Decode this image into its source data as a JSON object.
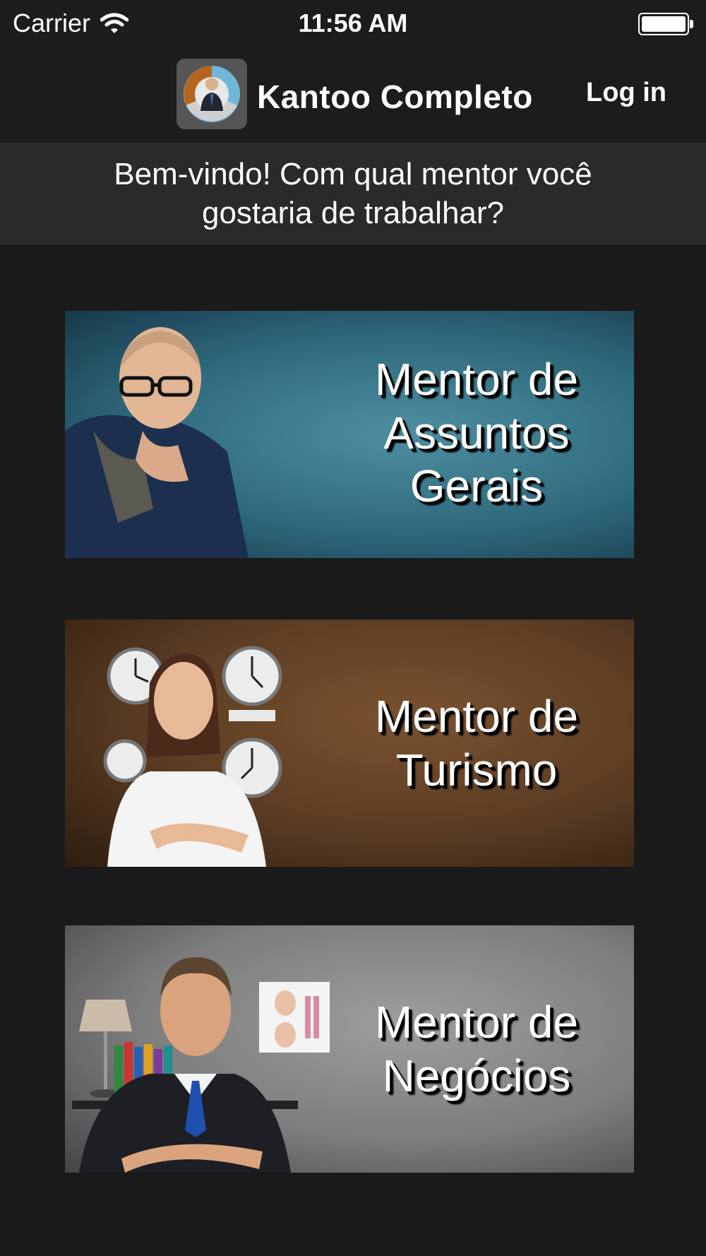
{
  "status_bar": {
    "carrier": "Carrier",
    "time": "11:56 AM",
    "battery_level": 1.0
  },
  "nav": {
    "title": "Kantoo Completo",
    "login_label": "Log in",
    "app_icon": "kantoo-app-icon"
  },
  "welcome": {
    "text": "Bem-vindo! Com qual mentor você gostaria de trabalhar?"
  },
  "mentors": [
    {
      "line1": "Mentor de",
      "line2": "Assuntos",
      "line3": "Gerais",
      "theme_color": "#3f7d90"
    },
    {
      "line1": "Mentor de",
      "line2": "Turismo",
      "theme_color": "#6a4528"
    },
    {
      "line1": "Mentor de",
      "line2": "Negócios",
      "theme_color": "#8a8a8a"
    }
  ],
  "colors": {
    "background": "#1a1a1a",
    "bar": "#1c1c1c",
    "banner": "#2a2a2a",
    "text": "#ffffff"
  }
}
